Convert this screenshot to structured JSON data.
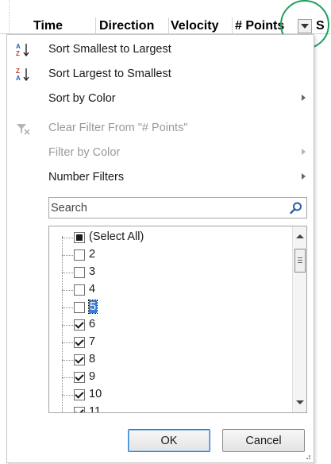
{
  "header": {
    "columns": [
      "Time",
      "Direction",
      "Velocity",
      "# Points",
      "S"
    ]
  },
  "menu": {
    "sort_asc": "Sort Smallest to Largest",
    "sort_desc": "Sort Largest to Smallest",
    "sort_color": "Sort by Color",
    "clear_filter": "Clear Filter From \"# Points\"",
    "filter_color": "Filter by Color",
    "number_filters": "Number Filters"
  },
  "search": {
    "placeholder": "Search"
  },
  "list": {
    "items": [
      {
        "label": "(Select All)",
        "state": "partial"
      },
      {
        "label": "2",
        "state": "unchecked"
      },
      {
        "label": "3",
        "state": "unchecked"
      },
      {
        "label": "4",
        "state": "unchecked"
      },
      {
        "label": "5",
        "state": "unchecked"
      },
      {
        "label": "6",
        "state": "checked"
      },
      {
        "label": "7",
        "state": "checked"
      },
      {
        "label": "8",
        "state": "checked"
      },
      {
        "label": "9",
        "state": "checked"
      },
      {
        "label": "10",
        "state": "checked"
      },
      {
        "label": "11",
        "state": "checked"
      }
    ]
  },
  "buttons": {
    "ok": "OK",
    "cancel": "Cancel"
  },
  "colors": {
    "highlight_ring": "#1ea05a",
    "selection": "#3a7bd5"
  },
  "icons": {
    "sort_asc": "sort-a-z-icon",
    "sort_desc": "sort-z-a-icon",
    "clear_filter": "clear-filter-icon",
    "search": "magnifier-icon",
    "filter_dropdown": "dropdown-arrow-icon"
  }
}
